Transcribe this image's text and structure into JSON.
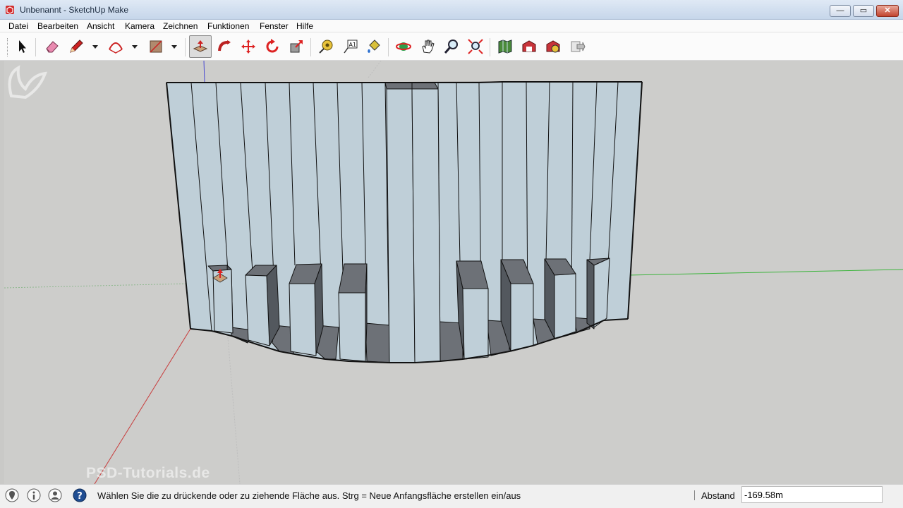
{
  "window": {
    "title": "Unbenannt - SketchUp Make",
    "minimize_glyph": "—",
    "maximize_glyph": "▭",
    "close_glyph": "✕"
  },
  "menu": {
    "items": [
      "Datei",
      "Bearbeiten",
      "Ansicht",
      "Kamera",
      "Zeichnen",
      "Funktionen",
      "Fenster",
      "Hilfe"
    ]
  },
  "toolbar": {
    "tools": [
      {
        "name": "select-icon"
      },
      {
        "name": "eraser-icon"
      },
      {
        "name": "pencil-line-icon"
      },
      {
        "name": "arc-icon"
      },
      {
        "name": "rectangle-shape-icon"
      },
      {
        "name": "push-pull-icon",
        "active": true
      },
      {
        "name": "follow-me-icon"
      },
      {
        "name": "move-icon"
      },
      {
        "name": "rotate-icon"
      },
      {
        "name": "scale-offset-icon"
      },
      {
        "name": "tape-measure-icon"
      },
      {
        "name": "text-label-icon"
      },
      {
        "name": "paint-bucket-icon"
      },
      {
        "name": "orbit-icon"
      },
      {
        "name": "pan-hand-icon"
      },
      {
        "name": "zoom-icon"
      },
      {
        "name": "zoom-extents-icon"
      },
      {
        "name": "map-location-icon"
      },
      {
        "name": "warehouse-share-icon"
      },
      {
        "name": "extension-warehouse-icon"
      },
      {
        "name": "layout-send-icon"
      }
    ]
  },
  "watermark": {
    "text": "PSD-Tutorials.de"
  },
  "statusbar": {
    "hint": "Wählen Sie die zu drückende oder zu ziehende Fläche aus.  Strg = Neue Anfangsfläche erstellen ein/aus",
    "measure_label": "Abstand",
    "measure_value": "-169.58m"
  },
  "colors": {
    "model_face_light": "#bfcfd8",
    "model_face_dark": "#6d7177",
    "viewport_bg": "#cdcdcb",
    "axis_red": "#c83c3c",
    "axis_green": "#3cb43c",
    "axis_blue": "#4a4ad2",
    "close_button": "#c2442e"
  }
}
